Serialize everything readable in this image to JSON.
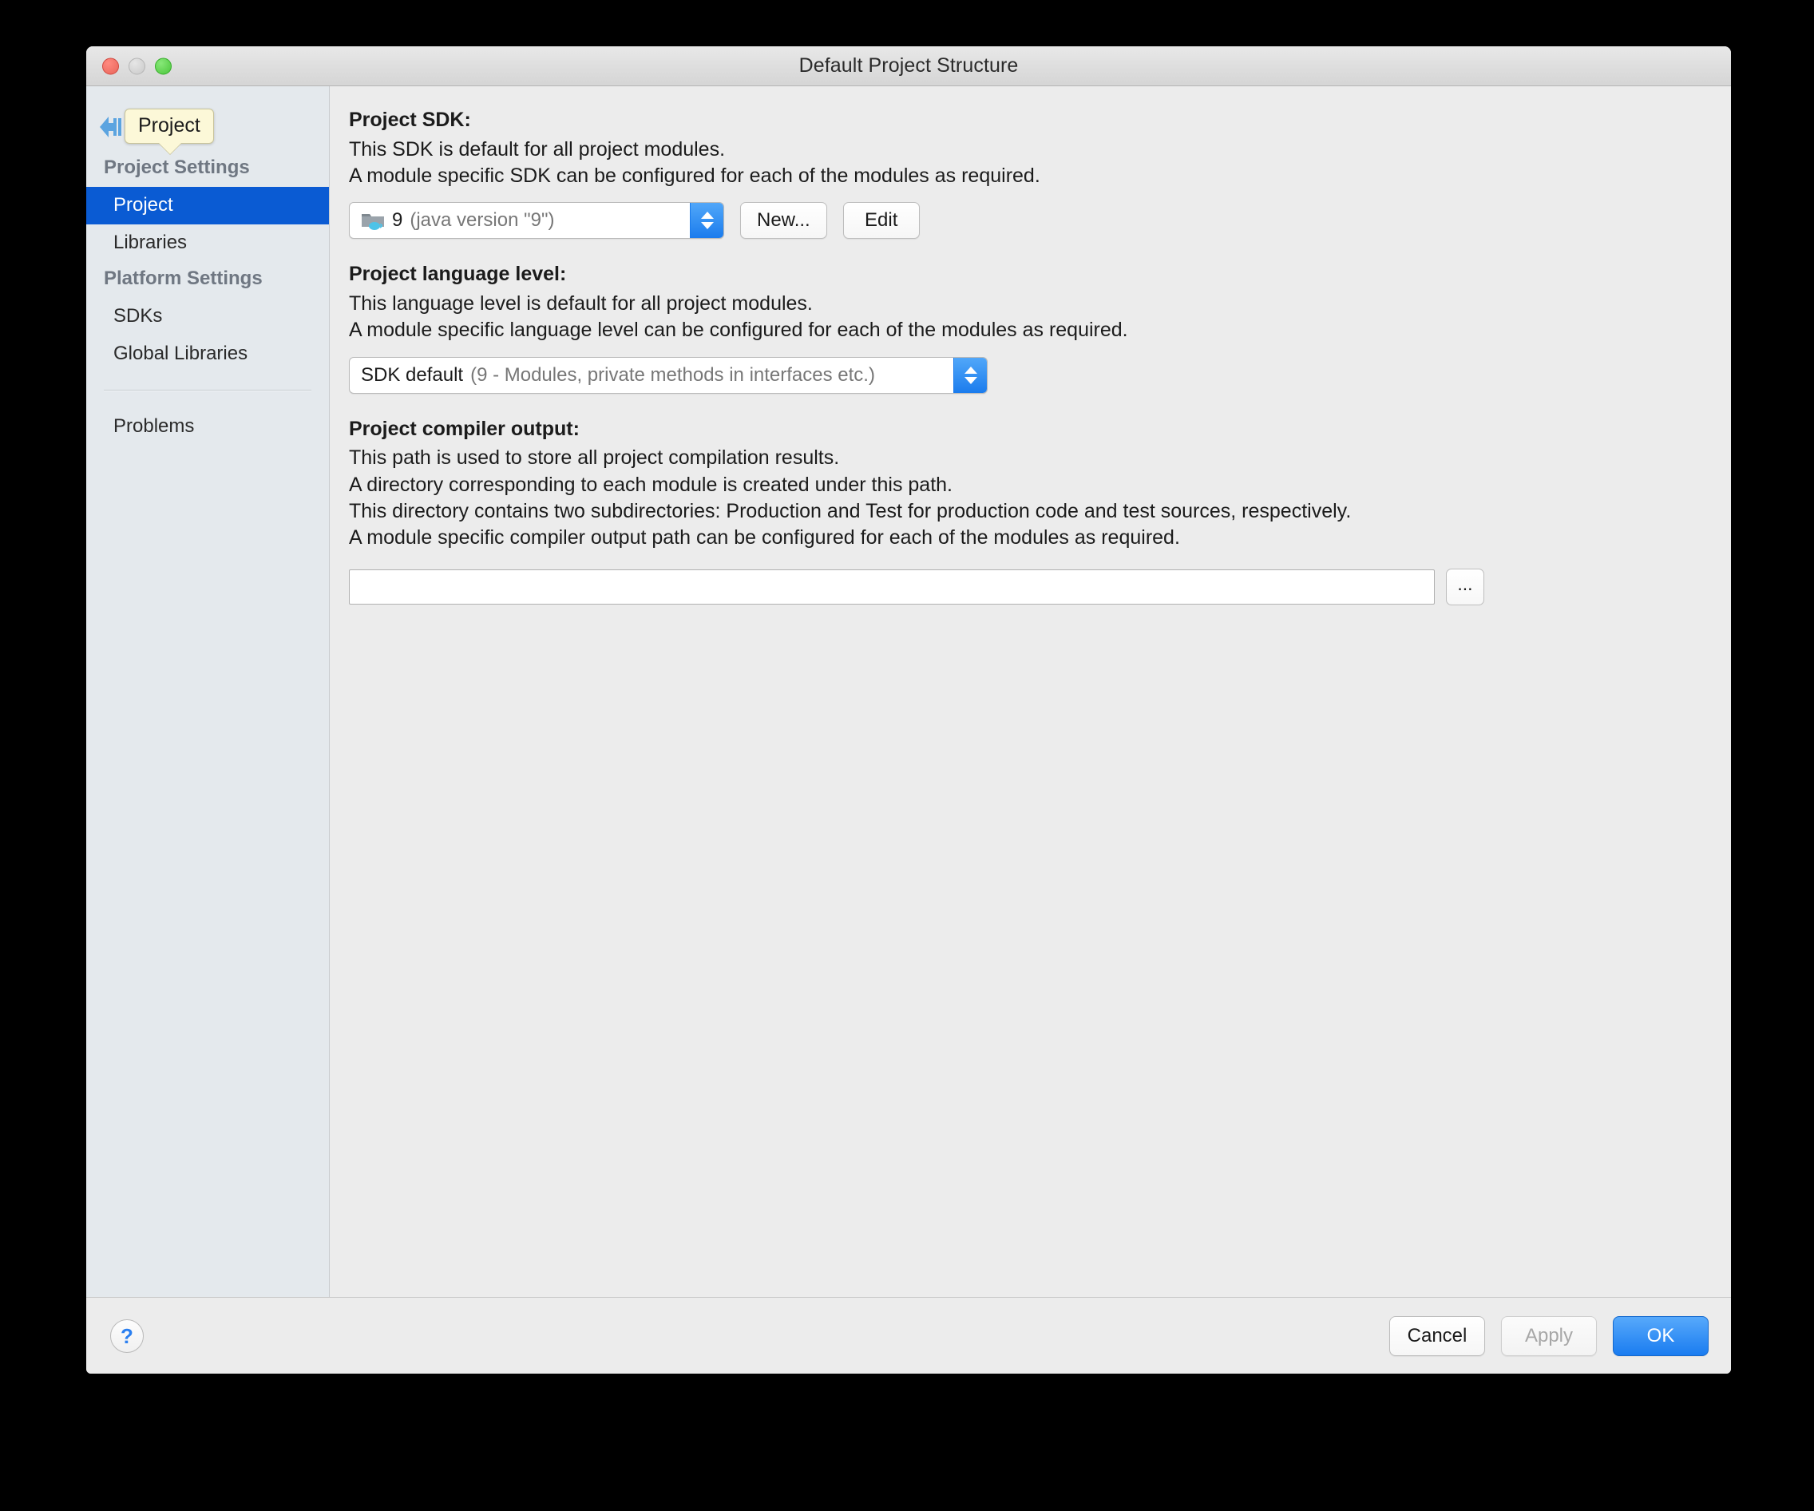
{
  "window": {
    "title": "Default Project Structure",
    "traffic_lights": [
      "close",
      "minimize",
      "maximize"
    ]
  },
  "sidebar": {
    "tooltip": "Project",
    "back_icon": "back-arrow-icon",
    "groups": [
      {
        "header": "Project Settings",
        "items": [
          {
            "label": "Project",
            "selected": true
          },
          {
            "label": "Libraries",
            "selected": false
          }
        ]
      },
      {
        "header": "Platform Settings",
        "items": [
          {
            "label": "SDKs",
            "selected": false
          },
          {
            "label": "Global Libraries",
            "selected": false
          }
        ]
      }
    ],
    "extra": {
      "label": "Problems"
    }
  },
  "main": {
    "sdk": {
      "title": "Project SDK:",
      "desc1": "This SDK is default for all project modules.",
      "desc2": "A module specific SDK can be configured for each of the modules as required.",
      "value_name": "9",
      "value_detail": "(java version \"9\")",
      "new_button": "New...",
      "edit_button": "Edit"
    },
    "language_level": {
      "title": "Project language level:",
      "desc1": "This language level is default for all project modules.",
      "desc2": "A module specific language level can be configured for each of the modules as required.",
      "value_name": "SDK default",
      "value_detail": "(9 - Modules, private methods in interfaces etc.)"
    },
    "compiler_output": {
      "title": "Project compiler output:",
      "desc1": "This path is used to store all project compilation results.",
      "desc2": "A directory corresponding to each module is created under this path.",
      "desc3": "This directory contains two subdirectories: Production and Test for production code and test sources, respectively.",
      "desc4": "A module specific compiler output path can be configured for each of the modules as required.",
      "path_value": "",
      "path_placeholder": "",
      "browse_button": "..."
    }
  },
  "footer": {
    "help": "?",
    "cancel": "Cancel",
    "apply": "Apply",
    "ok": "OK"
  },
  "colors": {
    "accent_blue": "#0a5bd3",
    "primary_button": "#1a7cf0",
    "tooltip_bg": "#fcf8d8",
    "sidebar_bg": "#e4e9ed",
    "window_bg": "#ececec"
  }
}
